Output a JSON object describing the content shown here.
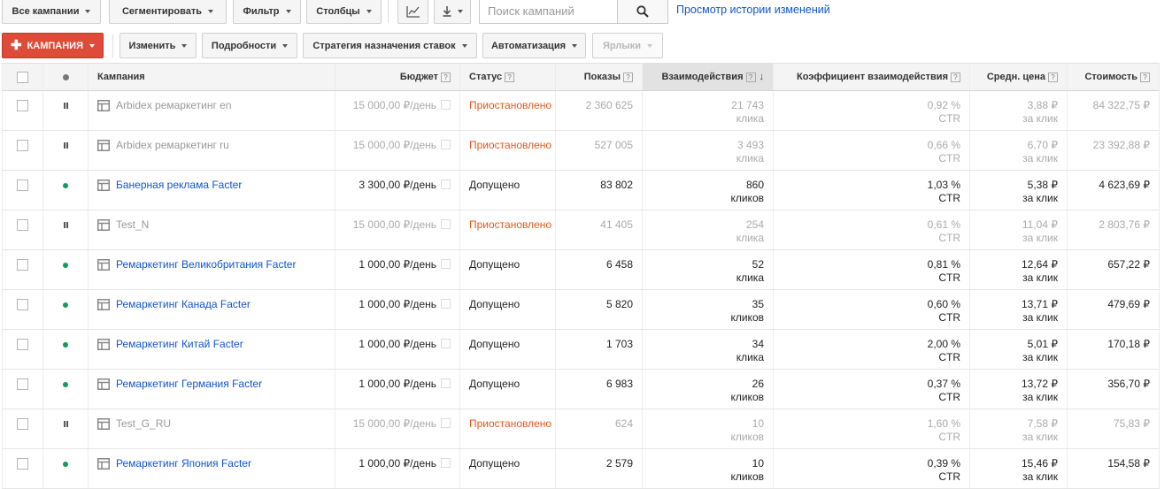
{
  "toolbar1": {
    "all_campaigns": "Все кампании",
    "segment": "Сегментировать",
    "filter": "Фильтр",
    "columns": "Столбцы",
    "search_placeholder": "Поиск кампаний",
    "history_link": "Просмотр истории изменений"
  },
  "toolbar2": {
    "new_campaign": "КАМПАНИЯ",
    "edit": "Изменить",
    "details": "Подробности",
    "bid_strategy": "Стратегия назначения ставок",
    "automation": "Автоматизация",
    "labels": "Ярлыки"
  },
  "table": {
    "headers": {
      "campaign": "Кампания",
      "budget": "Бюджет",
      "status": "Статус",
      "impressions": "Показы",
      "interactions": "Взаимодействия",
      "interaction_rate": "Коэффициент взаимодействия",
      "avg_cost": "Средн. цена",
      "cost": "Стоимость"
    },
    "help_mark": "?",
    "sort_arrow": "↓",
    "rows": [
      {
        "state": "paused",
        "name": "Arbidex ремаркетинг en",
        "budget": "15 000,00 ₽/день",
        "status": "Приостановлено",
        "impressions": "2 360 625",
        "interactions": "21 743",
        "interactions_unit": "клика",
        "rate": "0,92 %",
        "rate_unit": "CTR",
        "avg_cost": "3,88 ₽",
        "avg_cost_unit": "за клик",
        "cost": "84 322,75 ₽"
      },
      {
        "state": "paused",
        "name": "Arbidex ремаркетинг ru",
        "budget": "15 000,00 ₽/день",
        "status": "Приостановлено",
        "impressions": "527 005",
        "interactions": "3 493",
        "interactions_unit": "клика",
        "rate": "0,66 %",
        "rate_unit": "CTR",
        "avg_cost": "6,70 ₽",
        "avg_cost_unit": "за клик",
        "cost": "23 392,88 ₽"
      },
      {
        "state": "active",
        "name": "Банерная реклама Facter",
        "budget": "3 300,00 ₽/день",
        "status": "Допущено",
        "impressions": "83 802",
        "interactions": "860",
        "interactions_unit": "кликов",
        "rate": "1,03 %",
        "rate_unit": "CTR",
        "avg_cost": "5,38 ₽",
        "avg_cost_unit": "за клик",
        "cost": "4 623,69 ₽"
      },
      {
        "state": "paused",
        "name": "Test_N",
        "budget": "15 000,00 ₽/день",
        "status": "Приостановлено",
        "impressions": "41 405",
        "interactions": "254",
        "interactions_unit": "клика",
        "rate": "0,61 %",
        "rate_unit": "CTR",
        "avg_cost": "11,04 ₽",
        "avg_cost_unit": "за клик",
        "cost": "2 803,76 ₽"
      },
      {
        "state": "active",
        "name": "Ремаркетинг Великобритания Facter",
        "budget": "1 000,00 ₽/день",
        "status": "Допущено",
        "impressions": "6 458",
        "interactions": "52",
        "interactions_unit": "клика",
        "rate": "0,81 %",
        "rate_unit": "CTR",
        "avg_cost": "12,64 ₽",
        "avg_cost_unit": "за клик",
        "cost": "657,22 ₽"
      },
      {
        "state": "active",
        "name": "Ремаркетинг Канада Facter",
        "budget": "1 000,00 ₽/день",
        "status": "Допущено",
        "impressions": "5 820",
        "interactions": "35",
        "interactions_unit": "кликов",
        "rate": "0,60 %",
        "rate_unit": "CTR",
        "avg_cost": "13,71 ₽",
        "avg_cost_unit": "за клик",
        "cost": "479,69 ₽"
      },
      {
        "state": "active",
        "name": "Ремаркетинг Китай Facter",
        "budget": "1 000,00 ₽/день",
        "status": "Допущено",
        "impressions": "1 703",
        "interactions": "34",
        "interactions_unit": "клика",
        "rate": "2,00 %",
        "rate_unit": "CTR",
        "avg_cost": "5,01 ₽",
        "avg_cost_unit": "за клик",
        "cost": "170,18 ₽"
      },
      {
        "state": "active",
        "name": "Ремаркетинг Германия Facter",
        "budget": "1 000,00 ₽/день",
        "status": "Допущено",
        "impressions": "6 983",
        "interactions": "26",
        "interactions_unit": "кликов",
        "rate": "0,37 %",
        "rate_unit": "CTR",
        "avg_cost": "13,72 ₽",
        "avg_cost_unit": "за клик",
        "cost": "356,70 ₽"
      },
      {
        "state": "paused",
        "name": "Test_G_RU",
        "budget": "15 000,00 ₽/день",
        "status": "Приостановлено",
        "impressions": "624",
        "interactions": "10",
        "interactions_unit": "кликов",
        "rate": "1,60 %",
        "rate_unit": "CTR",
        "avg_cost": "7,58 ₽",
        "avg_cost_unit": "за клик",
        "cost": "75,83 ₽"
      },
      {
        "state": "active",
        "name": "Ремаркетинг Япония Facter",
        "budget": "1 000,00 ₽/день",
        "status": "Допущено",
        "impressions": "2 579",
        "interactions": "10",
        "interactions_unit": "кликов",
        "rate": "0,39 %",
        "rate_unit": "CTR",
        "avg_cost": "15,46 ₽",
        "avg_cost_unit": "за клик",
        "cost": "154,58 ₽"
      }
    ]
  },
  "colors": {
    "link": "#1155cc",
    "paused_status": "#e0591c",
    "active_dot": "#0f9d58",
    "new_button": "#dd4b39"
  },
  "icons": {
    "search": "search-icon",
    "chart": "line-chart-icon",
    "download": "download-icon",
    "campaign": "campaign-table-icon",
    "active": "active-status-dot-icon",
    "paused": "paused-status-icon",
    "sort": "sort-desc-arrow-icon",
    "edit_budget": "edit-budget-icon"
  }
}
